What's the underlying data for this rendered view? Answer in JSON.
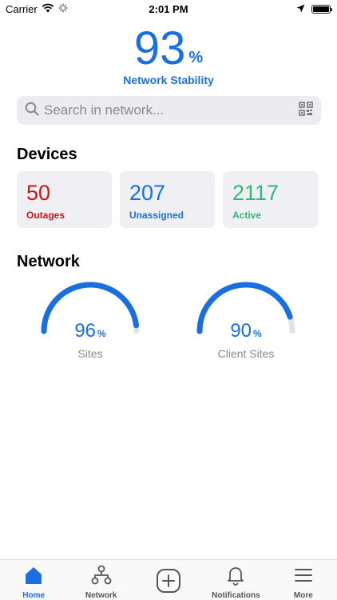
{
  "status_bar": {
    "carrier": "Carrier",
    "time": "2:01 PM"
  },
  "stability": {
    "value": "93",
    "unit": "%",
    "label": "Network Stability"
  },
  "search": {
    "placeholder": "Search in network..."
  },
  "devices": {
    "title": "Devices",
    "cards": [
      {
        "value": "50",
        "label": "Outages",
        "color": "#d0121b"
      },
      {
        "value": "207",
        "label": "Unassigned",
        "color": "#1a6fe0"
      },
      {
        "value": "2117",
        "label": "Active",
        "color": "#2fb879"
      }
    ]
  },
  "network": {
    "title": "Network",
    "gauges": [
      {
        "value": "96",
        "unit": "%",
        "label": "Sites",
        "fraction": 0.96
      },
      {
        "value": "90",
        "unit": "%",
        "label": "Client Sites",
        "fraction": 0.9
      }
    ]
  },
  "tabs": [
    {
      "label": "Home",
      "icon": "home-icon",
      "active": true
    },
    {
      "label": "Network",
      "icon": "network-icon",
      "active": false
    },
    {
      "label": "",
      "icon": "add-icon",
      "active": false
    },
    {
      "label": "Notifications",
      "icon": "bell-icon",
      "active": false
    },
    {
      "label": "More",
      "icon": "menu-icon",
      "active": false
    }
  ],
  "colors": {
    "accent": "#1a6fe0",
    "track": "#e3e3e3"
  }
}
